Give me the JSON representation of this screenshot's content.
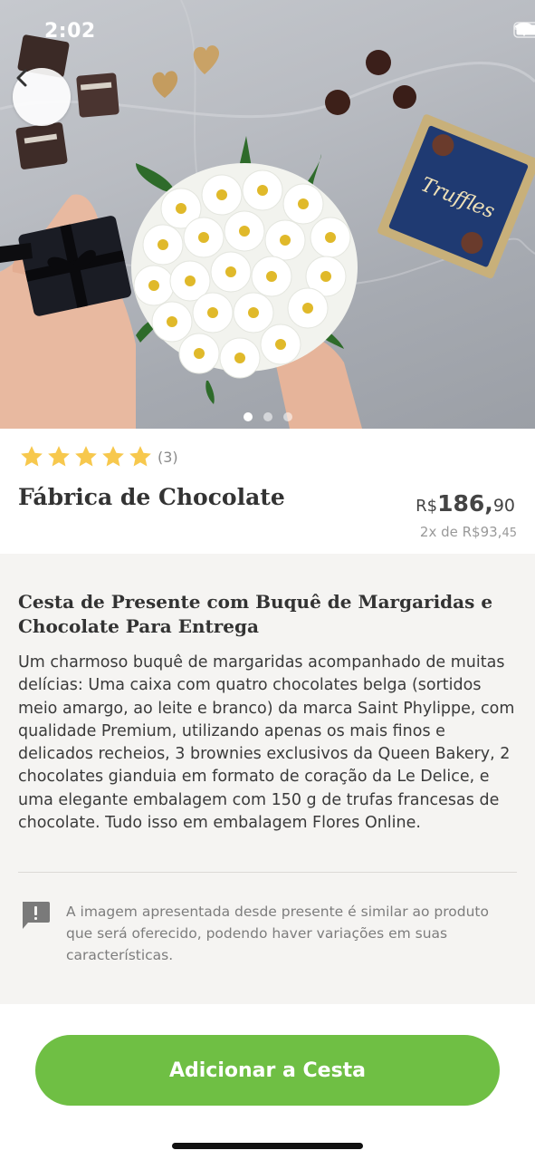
{
  "status_bar": {
    "time": "2:02",
    "icons": [
      "signal-icon",
      "wifi-icon",
      "battery-icon"
    ]
  },
  "gallery": {
    "image_description_icon": "product-photo",
    "slides": 3,
    "active_slide": 1
  },
  "product": {
    "rating": 5,
    "rating_count": "(3)",
    "name": "Fábrica de Chocolate",
    "price": {
      "currency": "R$",
      "integer": "186,",
      "cents": "90"
    },
    "installment": {
      "prefix": "2x de R$93,",
      "cents": "45"
    }
  },
  "description": {
    "title": "Cesta de Presente com Buquê de Margaridas e Chocolate Para Entrega",
    "body": "Um charmoso buquê de margaridas acompanhado de muitas delícias: Uma caixa com quatro chocolates belga (sortidos meio amargo, ao leite e branco) da marca Saint Phylippe, com qualidade Premium, utilizando apenas os mais finos e delicados recheios, 3 brownies exclusivos da Queen Bakery, 2 chocolates gianduia em formato de coração da Le Delice, e uma elegante embalagem com 150 g de trufas francesas de chocolate. Tudo isso em embalagem Flores Online.",
    "notice": "A imagem apresentada desde presente é similar ao produto que será oferecido, podendo haver variações em suas características."
  },
  "cta": {
    "label": "Adicionar a Cesta"
  },
  "colors": {
    "accent_green": "#6fbf44",
    "star_yellow": "#f7c84d",
    "panel_bg": "#f5f4f2"
  }
}
